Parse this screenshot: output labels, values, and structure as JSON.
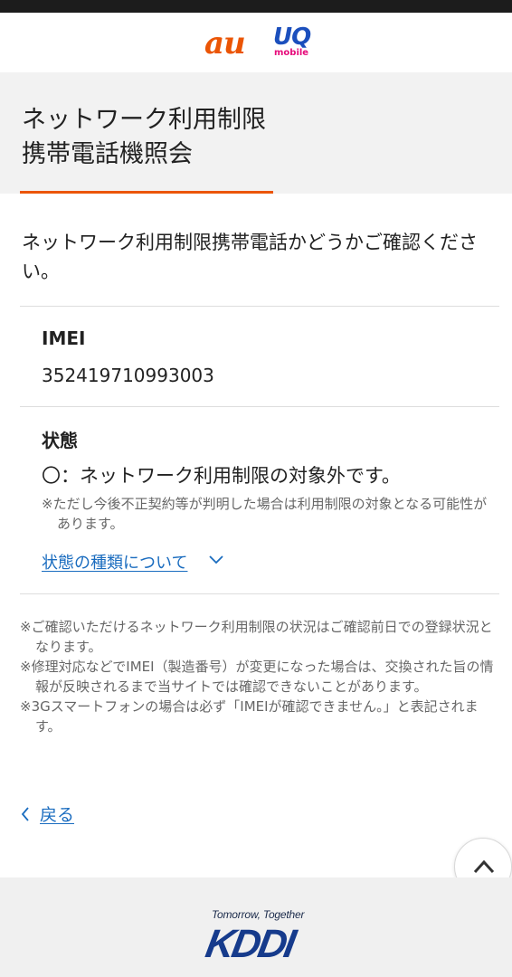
{
  "header": {
    "logo_au": "au",
    "logo_uq": "UQ",
    "logo_uq_sub": "mobile"
  },
  "page": {
    "title": "ネットワーク利用制限\n携帯電話機照会",
    "intro": "ネットワーク利用制限携帯電話かどうかご確認ください。"
  },
  "result": {
    "imei_label": "IMEI",
    "imei_value": "352419710993003",
    "status_label": "状態",
    "status_text": "〇：ネットワーク利用制限の対象外です。",
    "status_note": "※ただし今後不正契約等が判明した場合は利用制限の対象となる可能性があります。",
    "status_link": "状態の種類について"
  },
  "notes": [
    "※ご確認いただけるネットワーク利用制限の状況はご確認前日での登録状況となります。",
    "※修理対応などでIMEI（製造番号）が変更になった場合は、交換された旨の情報が反映されるまで当サイトでは確認できないことがあります。",
    "※3Gスマートフォンの場合は必ず「IMEIが確認できません。」と表記されます。"
  ],
  "nav": {
    "back_label": "戻る"
  },
  "footer": {
    "tagline": "Tomorrow, Together",
    "logo": "KDDI"
  },
  "colors": {
    "accent": "#eb5505",
    "link": "#1a6cbf",
    "brand_blue": "#163b8c"
  },
  "icons": {
    "back": "chevron-left-icon",
    "expand": "chevron-down-icon",
    "scroll_top": "chevron-up-icon"
  }
}
